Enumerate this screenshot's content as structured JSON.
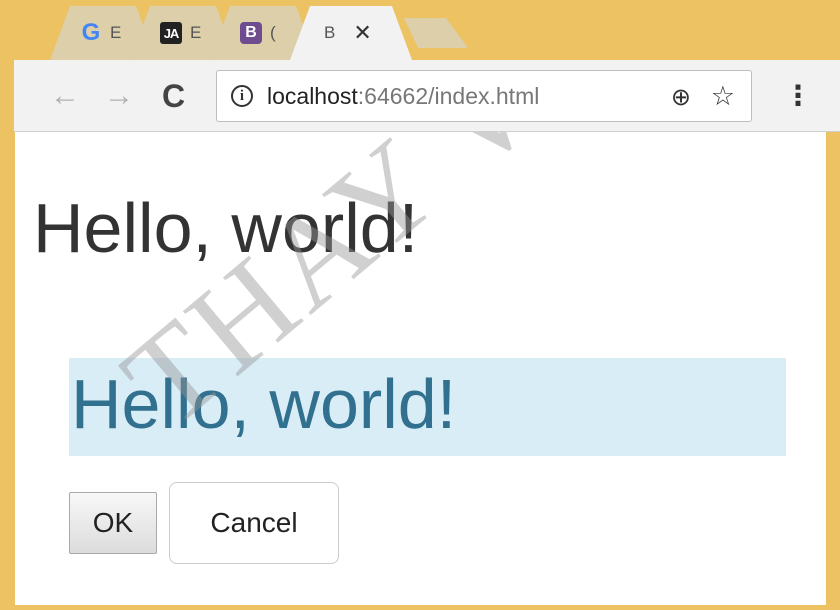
{
  "tabs": [
    {
      "favicon": "G",
      "favicon_name": "google-favicon-icon",
      "title": "E"
    },
    {
      "favicon": "JA",
      "favicon_name": "ja-favicon-icon",
      "title": "E"
    },
    {
      "favicon": "B",
      "favicon_name": "bootstrap-favicon-icon",
      "title": "("
    },
    {
      "title": "B",
      "close": "✕"
    }
  ],
  "toolbar": {
    "back": "←",
    "forward": "→",
    "reload": "C",
    "info": "i",
    "url_host": "localhost",
    "url_rest": ":64662/index.html",
    "zoom": "⊕",
    "star": "☆",
    "menu": "⋮"
  },
  "page": {
    "heading": "Hello, world!",
    "jumbotron_text": "Hello, world!",
    "ok_label": "OK",
    "cancel_label": "Cancel",
    "watermark": "THAY VU"
  }
}
